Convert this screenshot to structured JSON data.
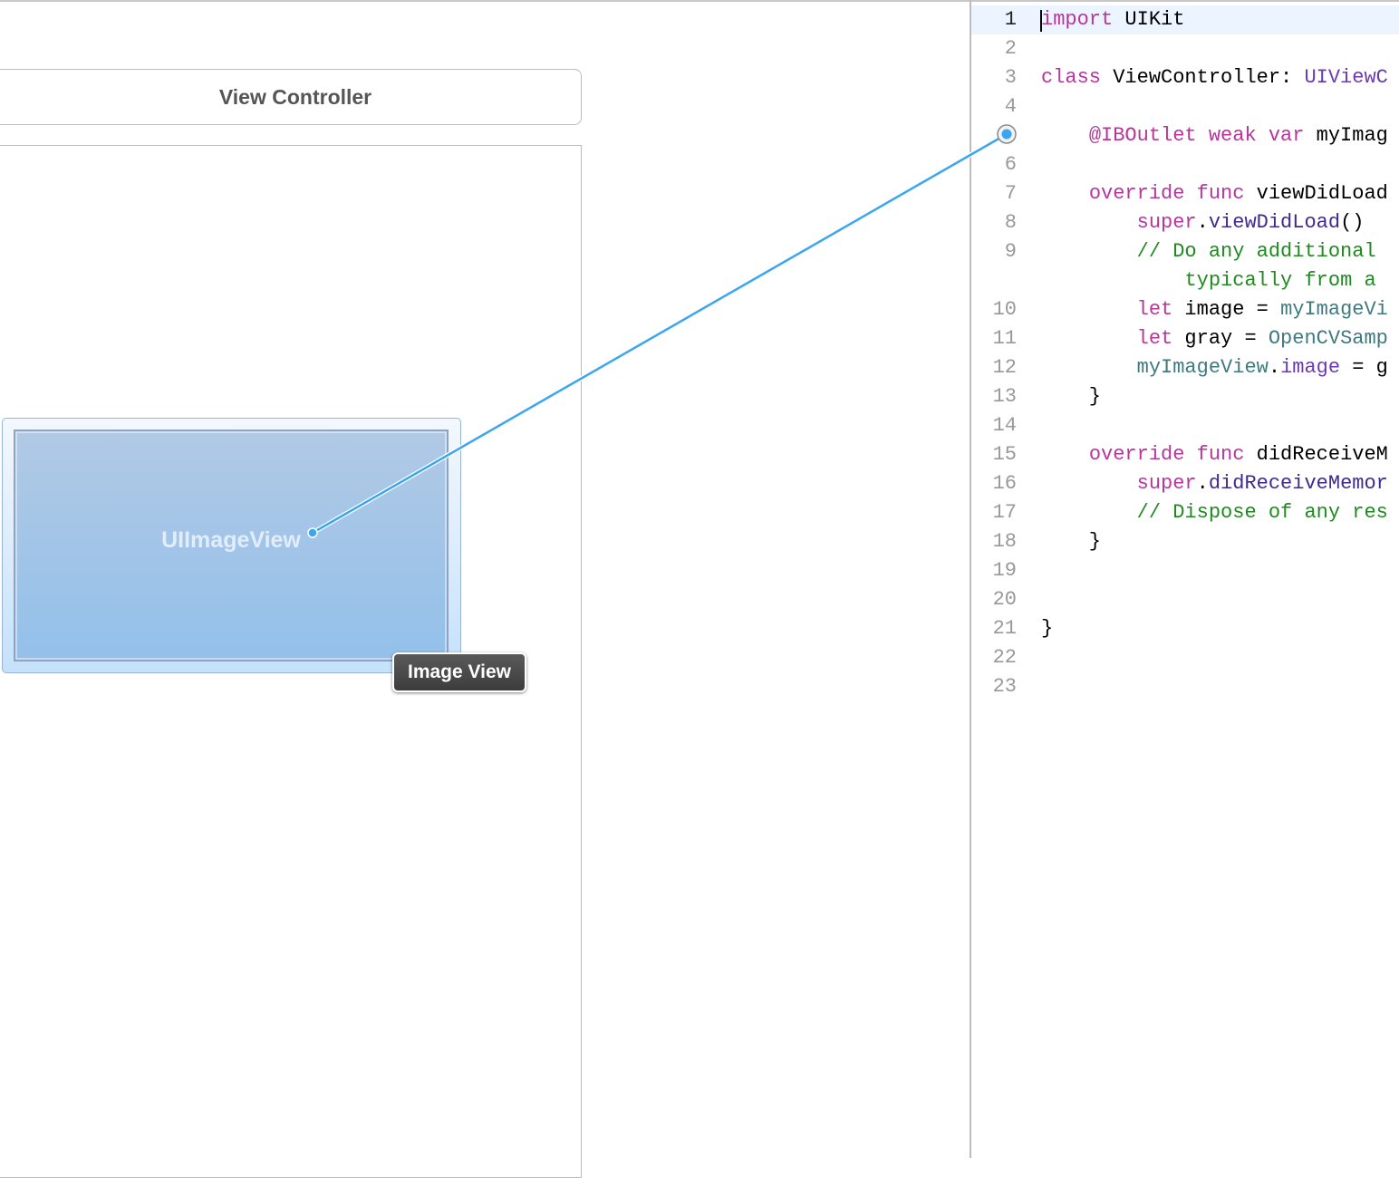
{
  "canvas": {
    "view_controller_title": "View Controller",
    "image_view_label": "UIImageView",
    "tooltip": "Image View"
  },
  "colors": {
    "keyword": "#b8359c",
    "plain": "#000000",
    "type": "#6a3bb0",
    "method": "#3f2a8f",
    "project": "#3e7a80",
    "comment": "#1f8a1f",
    "connection": "#3aa6f2"
  },
  "editor": {
    "lines": [
      {
        "n": "1",
        "t": [
          [
            "keyword",
            "import"
          ],
          [
            "plain",
            " UIKit"
          ]
        ]
      },
      {
        "n": "2",
        "t": []
      },
      {
        "n": "3",
        "t": [
          [
            "keyword",
            "class"
          ],
          [
            "plain",
            " ViewController: "
          ],
          [
            "type",
            "UIViewC"
          ]
        ]
      },
      {
        "n": "4",
        "t": []
      },
      {
        "n": "",
        "t": [
          [
            "plain",
            "    "
          ],
          [
            "keyword",
            "@IBOutlet weak var"
          ],
          [
            "plain",
            " myImag"
          ]
        ]
      },
      {
        "n": "6",
        "t": []
      },
      {
        "n": "7",
        "t": [
          [
            "plain",
            "    "
          ],
          [
            "keyword",
            "override func"
          ],
          [
            "plain",
            " viewDidLoad"
          ]
        ]
      },
      {
        "n": "8",
        "t": [
          [
            "plain",
            "        "
          ],
          [
            "keyword",
            "super"
          ],
          [
            "plain",
            "."
          ],
          [
            "method",
            "viewDidLoad"
          ],
          [
            "plain",
            "()"
          ]
        ]
      },
      {
        "n": "9",
        "t": [
          [
            "plain",
            "        "
          ],
          [
            "comment",
            "// Do any additional"
          ]
        ]
      },
      {
        "n": "",
        "t": [
          [
            "plain",
            "            "
          ],
          [
            "comment",
            "typically from a"
          ]
        ]
      },
      {
        "n": "10",
        "t": [
          [
            "plain",
            "        "
          ],
          [
            "keyword",
            "let"
          ],
          [
            "plain",
            " image = "
          ],
          [
            "project",
            "myImageVi"
          ]
        ]
      },
      {
        "n": "11",
        "t": [
          [
            "plain",
            "        "
          ],
          [
            "keyword",
            "let"
          ],
          [
            "plain",
            " gray = "
          ],
          [
            "project",
            "OpenCVSamp"
          ]
        ]
      },
      {
        "n": "12",
        "t": [
          [
            "plain",
            "        "
          ],
          [
            "project",
            "myImageView"
          ],
          [
            "plain",
            "."
          ],
          [
            "type",
            "image"
          ],
          [
            "plain",
            " = g"
          ]
        ]
      },
      {
        "n": "13",
        "t": [
          [
            "plain",
            "    }"
          ]
        ]
      },
      {
        "n": "14",
        "t": []
      },
      {
        "n": "15",
        "t": [
          [
            "plain",
            "    "
          ],
          [
            "keyword",
            "override func"
          ],
          [
            "plain",
            " didReceiveM"
          ]
        ]
      },
      {
        "n": "16",
        "t": [
          [
            "plain",
            "        "
          ],
          [
            "keyword",
            "super"
          ],
          [
            "plain",
            "."
          ],
          [
            "method",
            "didReceiveMemor"
          ]
        ]
      },
      {
        "n": "17",
        "t": [
          [
            "plain",
            "        "
          ],
          [
            "comment",
            "// Dispose of any res"
          ]
        ]
      },
      {
        "n": "18",
        "t": [
          [
            "plain",
            "    }"
          ]
        ]
      },
      {
        "n": "19",
        "t": []
      },
      {
        "n": "20",
        "t": []
      },
      {
        "n": "21",
        "t": [
          [
            "plain",
            "}"
          ]
        ]
      },
      {
        "n": "22",
        "t": []
      },
      {
        "n": "23",
        "t": []
      }
    ]
  }
}
